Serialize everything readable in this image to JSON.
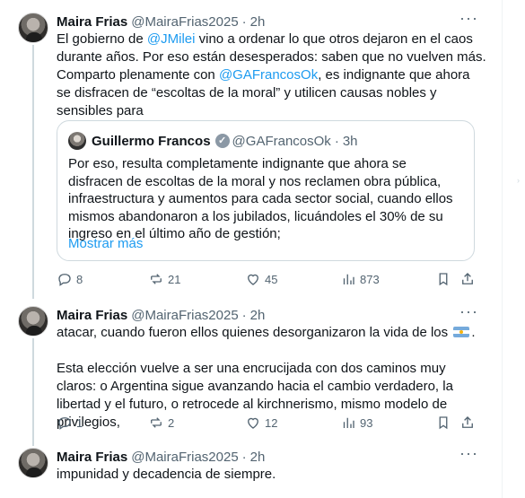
{
  "tweets": [
    {
      "author": "Maira Frias",
      "handle": "@MairaFrias2025",
      "time": "2h",
      "text": {
        "part1": "El gobierno de ",
        "mention1": "@JMilei",
        "part2": " vino a ordenar lo que otros dejaron en el caos durante años. Por eso están desesperados: saben que no vuelven más. Comparto plenamente con ",
        "mention2": "@GAFrancosOk",
        "part3": ", es indignante que ahora se disfracen de “escoltas de la moral” y utilicen causas nobles y sensibles para"
      },
      "quote": {
        "author": "Guillermo Francos",
        "handle": "@GAFrancosOk",
        "time": "3h",
        "text": "Por eso, resulta completamente indignante que ahora se disfracen de escoltas de la moral y nos reclamen obra pública, infraestructura y aumentos para cada sector social, cuando ellos mismos abandonaron a los jubilados, licuándoles el 30% de su ingreso en el último año de gestión;",
        "show_more": "Mostrar más"
      },
      "stats": {
        "replies": "8",
        "reposts": "21",
        "likes": "45",
        "views": "873"
      }
    },
    {
      "author": "Maira Frias",
      "handle": "@MairaFrias2025",
      "time": "2h",
      "text": {
        "line1": "atacar, cuando fueron ellos quienes desorganizaron la vida de los",
        "line1_end": ".",
        "paragraph2": "Esta elección vuelve a ser una encrucijada con dos caminos muy claros: o Argentina sigue avanzando hacia el cambio verdadero, la libertad y el futuro, o retrocede al kirchnerismo, mismo modelo de privilegios,"
      },
      "stats": {
        "replies": "1",
        "reposts": "2",
        "likes": "12",
        "views": "93"
      }
    },
    {
      "author": "Maira Frias",
      "handle": "@MairaFrias2025",
      "time": "2h",
      "text": {
        "line1": "impunidad y decadencia de siempre."
      }
    }
  ],
  "colors": {
    "accent": "#1d9bf0",
    "muted": "#536471",
    "border": "#cfd9de"
  },
  "icons": [
    "reply-icon",
    "repost-icon",
    "like-icon",
    "views-icon",
    "bookmark-icon",
    "share-icon",
    "more-icon",
    "verified-icon",
    "argentina-flag-icon"
  ]
}
